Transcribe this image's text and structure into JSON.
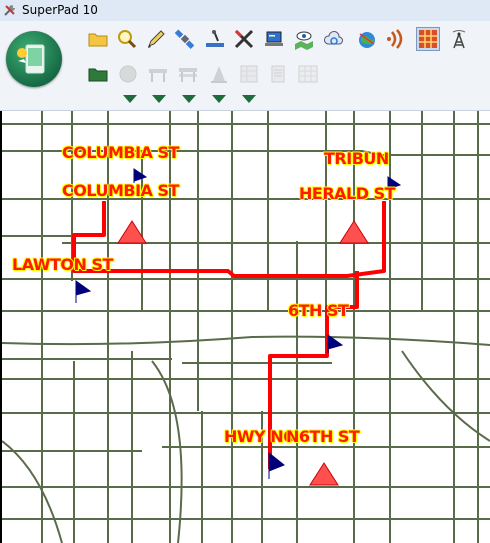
{
  "window": {
    "title": "SuperPad 10",
    "icon": "tools-icon"
  },
  "toolbar": {
    "row1": [
      {
        "name": "open-folder-icon"
      },
      {
        "name": "magnifier-icon"
      },
      {
        "name": "pencil-icon"
      },
      {
        "name": "satellite-icon"
      },
      {
        "name": "measure-icon"
      },
      {
        "name": "cross-tool-icon"
      },
      {
        "name": "laptop-icon"
      },
      {
        "name": "eye-map-icon"
      },
      {
        "name": "cloud-refresh-icon"
      },
      {
        "name": "globe-icon"
      },
      {
        "name": "signal-icon"
      },
      {
        "name": "grid-icon"
      },
      {
        "name": "tower-icon"
      }
    ],
    "row2": [
      {
        "name": "green-folder-icon",
        "enabled": true
      },
      {
        "name": "circle-icon",
        "enabled": false
      },
      {
        "name": "barrier-icon",
        "enabled": false
      },
      {
        "name": "barricade-icon",
        "enabled": false
      },
      {
        "name": "cone-icon",
        "enabled": false
      },
      {
        "name": "table-icon",
        "enabled": false
      },
      {
        "name": "document-icon",
        "enabled": false
      },
      {
        "name": "spreadsheet-icon",
        "enabled": false
      }
    ],
    "dropdown_count": 5
  },
  "map": {
    "route_color": "#ff0000",
    "street_color": "#5a6b4a",
    "labels": [
      {
        "id": "columbia-1",
        "text": "COLUMBIA ST"
      },
      {
        "id": "columbia-2",
        "text": "COLUMBIA ST"
      },
      {
        "id": "tribun",
        "text": "TRIBUN"
      },
      {
        "id": "herald",
        "text": "HERALD ST"
      },
      {
        "id": "lawton",
        "text": "LAWTON ST"
      },
      {
        "id": "sixth",
        "text": "6TH ST"
      },
      {
        "id": "hwy",
        "text": "HWY N6"
      },
      {
        "id": "n6th",
        "text": "N6TH ST"
      }
    ]
  }
}
